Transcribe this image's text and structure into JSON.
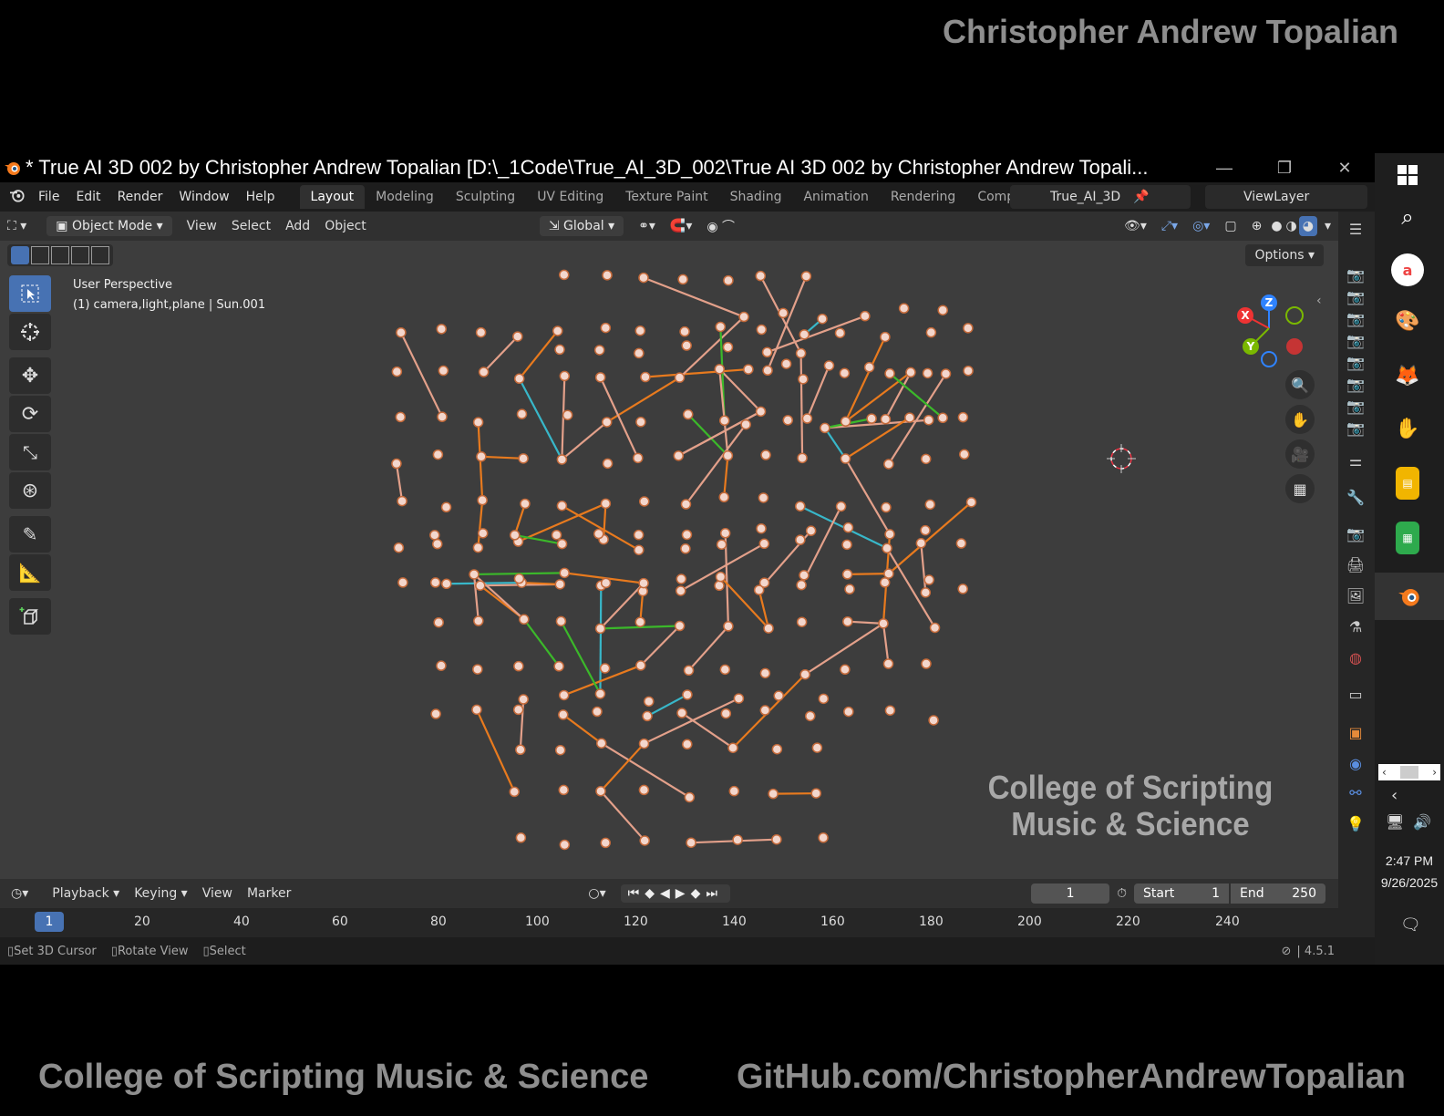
{
  "watermarks": {
    "top_right": "Christopher Andrew Topalian",
    "bottom_left": "College of Scripting Music & Science",
    "bottom_right": "GitHub.com/ChristopherAndrewTopalian",
    "viewport_line1": "College of Scripting",
    "viewport_line2": "Music & Science"
  },
  "window": {
    "title": "* True AI 3D 002 by Christopher Andrew Topalian [D:\\_1Code\\True_AI_3D_002\\True AI 3D 002 by Christopher Andrew Topali...",
    "minimize": "—",
    "restore": "❐",
    "close": "✕"
  },
  "menu": {
    "file": "File",
    "edit": "Edit",
    "render": "Render",
    "window": "Window",
    "help": "Help"
  },
  "workspaces": [
    "Layout",
    "Modeling",
    "Sculpting",
    "UV Editing",
    "Texture Paint",
    "Shading",
    "Animation",
    "Rendering",
    "Compositing"
  ],
  "scene": {
    "name": "True_AI_3D",
    "view_layer": "ViewLayer"
  },
  "header3d": {
    "mode": "Object Mode",
    "view": "View",
    "select": "Select",
    "add": "Add",
    "object": "Object",
    "orientation": "Global"
  },
  "viewport": {
    "perspective": "User Perspective",
    "collection": "(1) camera,light,plane | Sun.001",
    "options": "Options",
    "gizmo": {
      "x": "X",
      "y": "Y",
      "z": "Z"
    }
  },
  "timeline": {
    "playback": "Playback",
    "keying": "Keying",
    "view": "View",
    "marker": "Marker",
    "current_frame": "1",
    "start_label": "Start",
    "start": "1",
    "end_label": "End",
    "end": "250",
    "ruler": [
      "20",
      "40",
      "60",
      "80",
      "100",
      "120",
      "140",
      "160",
      "180",
      "200",
      "220",
      "240"
    ],
    "ruler_current": "1"
  },
  "status": {
    "left": "Set 3D Cursor",
    "middle": "Rotate View",
    "right": "Select",
    "version": "4.5.1"
  },
  "taskbar": {
    "time": "2:47 PM",
    "date": "9/26/2025"
  },
  "colors": {
    "accent": "#4772b3",
    "viewport_bg": "#3d3d3d",
    "header": "#303030",
    "strut_orange": "#e87a1e",
    "strut_pink": "#e3a08a",
    "strut_green": "#3bb82a",
    "strut_cyan": "#38b7c9"
  }
}
